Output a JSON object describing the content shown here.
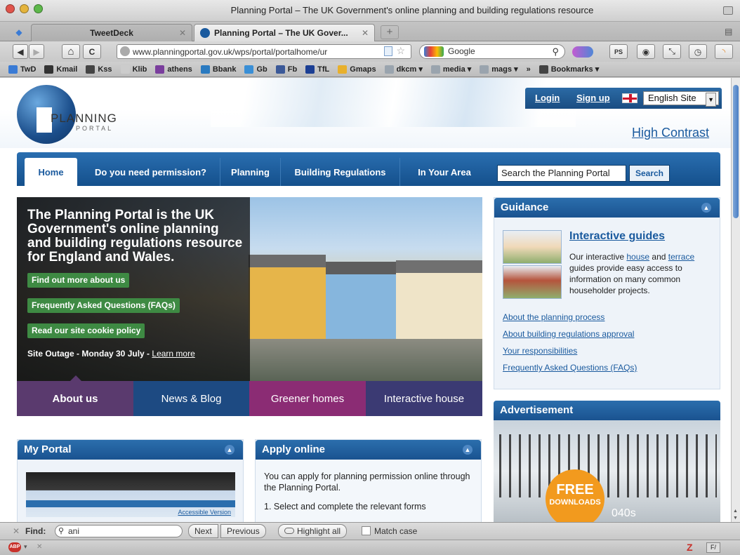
{
  "window": {
    "title": "Planning Portal – The UK Government's online planning and building regulations resource"
  },
  "tabs": [
    {
      "label": "TweetDeck"
    },
    {
      "label": "Planning Portal – The UK Gover..."
    }
  ],
  "toolbar": {
    "url": "www.planningportal.gov.uk/wps/portal/portalhome/ur",
    "search_engine": "Google",
    "back": "◀",
    "forward": "▶",
    "home": "⌂",
    "reload": "C"
  },
  "bookmarks": [
    {
      "label": "TwD",
      "color": "#3a7bd5"
    },
    {
      "label": "Kmail",
      "color": "#333333"
    },
    {
      "label": "Kss",
      "color": "#444444"
    },
    {
      "label": "Klib",
      "color": "#cccccc"
    },
    {
      "label": "athens",
      "color": "#7a3e9d"
    },
    {
      "label": "Bbank",
      "color": "#2a7ac0"
    },
    {
      "label": "Gb",
      "color": "#3a8fd6"
    },
    {
      "label": "Fb",
      "color": "#3b5998"
    },
    {
      "label": "TfL",
      "color": "#1c3f94"
    },
    {
      "label": "Gmaps",
      "color": "#e8b02c"
    },
    {
      "label": "dkcm ▾",
      "color": "#9aa4ae"
    },
    {
      "label": "media ▾",
      "color": "#9aa4ae"
    },
    {
      "label": "mags ▾",
      "color": "#9aa4ae"
    },
    {
      "label": "»",
      "color": ""
    },
    {
      "label": "Bookmarks ▾",
      "color": "#444444"
    }
  ],
  "site": {
    "logo_line1": "PLANNING",
    "logo_line2": "PORTAL",
    "login": "Login",
    "signup": "Sign up",
    "language": "English Site",
    "high_contrast": "High Contrast",
    "nav": [
      "Home",
      "Do you need permission?",
      "Planning",
      "Building Regulations",
      "In Your Area"
    ],
    "search_placeholder": "Search the Planning Portal",
    "search_button": "Search"
  },
  "hero": {
    "title": "The Planning Portal is the UK Government's online planning and building regulations resource for England and Wales.",
    "buttons": [
      "Find out more about us",
      "Frequently Asked Questions (FAQs)",
      "Read our site cookie policy"
    ],
    "outage_text": "Site Outage - Monday 30 July -",
    "outage_link": "Learn more",
    "tabs": [
      "About us",
      "News & Blog",
      "Greener homes",
      "Interactive house"
    ]
  },
  "guidance": {
    "title": "Guidance",
    "ig_title": "Interactive guides",
    "ig_pre": "Our interactive",
    "ig_house": "house",
    "ig_and": "and",
    "ig_terrace": "terrace",
    "ig_post": "guides provide easy access to information on many common householder projects.",
    "links": [
      "About the planning process",
      "About building regulations approval",
      "Your responsibilities",
      "Frequently Asked Questions (FAQs)"
    ]
  },
  "advert": {
    "title": "Advertisement",
    "free": "FREE",
    "downloads": "DOWNLOADS",
    "extra": "040s"
  },
  "myportal": {
    "title": "My Portal",
    "accessible": "Accessible Version"
  },
  "apply": {
    "title": "Apply online",
    "text": "You can apply for planning permission online through the Planning Portal.",
    "step1": "1.  Select and complete the relevant forms"
  },
  "findbar": {
    "label": "Find:",
    "value": "ani",
    "next": "Next",
    "previous": "Previous",
    "highlight": "Highlight all",
    "match_case": "Match case"
  }
}
